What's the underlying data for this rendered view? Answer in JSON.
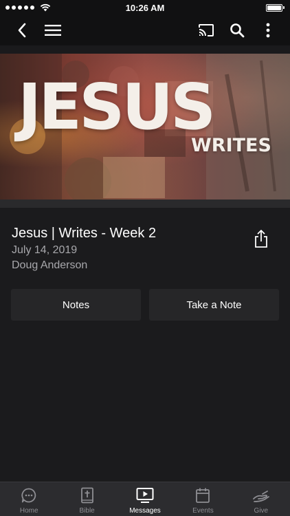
{
  "status_bar": {
    "time": "10:26 AM"
  },
  "nav": {
    "back_icon": "chevron-left-icon",
    "menu_icon": "hamburger-menu-icon",
    "cast_icon": "cast-icon",
    "search_icon": "search-icon",
    "more_icon": "vertical-ellipsis-icon"
  },
  "hero": {
    "title": "JESUS",
    "subtitle": "WRITES"
  },
  "message": {
    "title": "Jesus | Writes - Week 2",
    "date": "July 14, 2019",
    "speaker": "Doug Anderson",
    "share_icon": "share-icon"
  },
  "actions": {
    "notes_label": "Notes",
    "take_note_label": "Take a Note"
  },
  "tabs": [
    {
      "label": "Home",
      "icon": "chat-bubble-icon",
      "active": false
    },
    {
      "label": "Bible",
      "icon": "bible-icon",
      "active": false
    },
    {
      "label": "Messages",
      "icon": "play-screen-icon",
      "active": true
    },
    {
      "label": "Events",
      "icon": "calendar-icon",
      "active": false
    },
    {
      "label": "Give",
      "icon": "give-hand-icon",
      "active": false
    }
  ],
  "colors": {
    "background": "#1b1b1d",
    "bar": "#111112",
    "button": "#262628",
    "tab_bar": "#2c2c2f",
    "secondary_text": "#a8a8ac",
    "inactive_tab": "#8e8e93"
  }
}
